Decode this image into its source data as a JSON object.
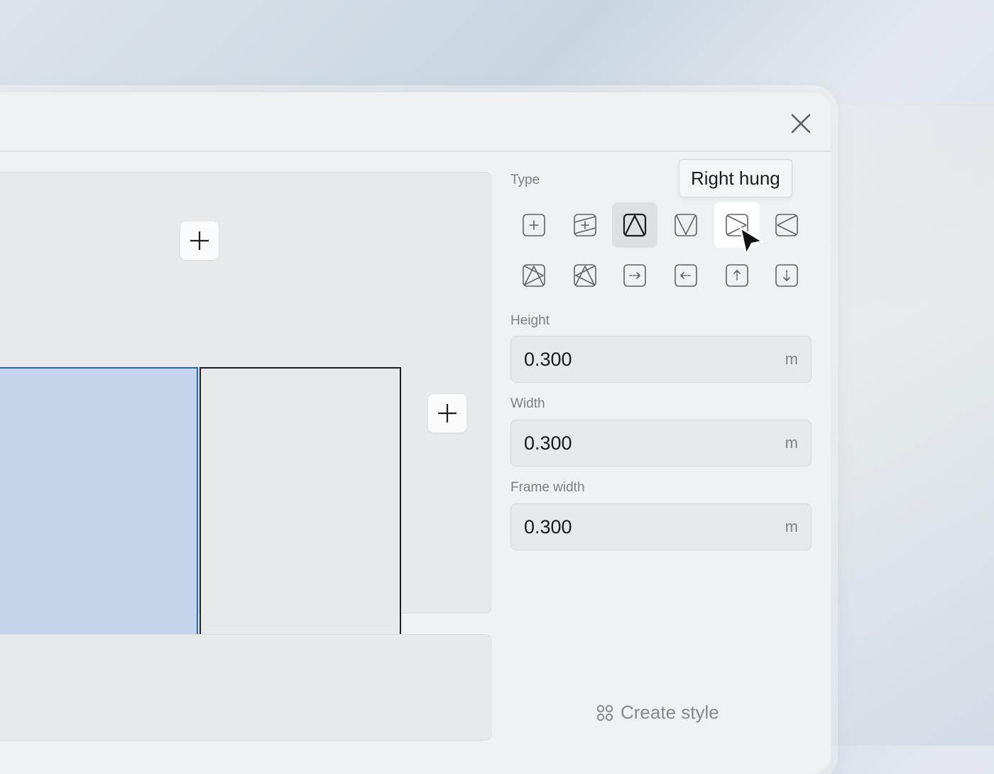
{
  "panel": {
    "type_label": "Type",
    "tooltip": "Right hung",
    "height": {
      "label": "Height",
      "value": "0.300",
      "unit": "m"
    },
    "width": {
      "label": "Width",
      "value": "0.300",
      "unit": "m"
    },
    "frame_width": {
      "label": "Frame width",
      "value": "0.300",
      "unit": "m"
    },
    "create_style_label": "Create style"
  },
  "type_options": [
    {
      "icon": "fixed-plus-icon",
      "state": "normal"
    },
    {
      "icon": "fixed-hatched-icon",
      "state": "normal"
    },
    {
      "icon": "top-hung-icon",
      "state": "active"
    },
    {
      "icon": "bottom-hung-icon",
      "state": "normal"
    },
    {
      "icon": "right-hung-icon",
      "state": "hover"
    },
    {
      "icon": "left-hung-icon",
      "state": "normal"
    },
    {
      "icon": "tilt-turn-left-icon",
      "state": "normal"
    },
    {
      "icon": "tilt-turn-right-icon",
      "state": "normal"
    },
    {
      "icon": "slide-right-icon",
      "state": "normal"
    },
    {
      "icon": "slide-left-icon",
      "state": "normal"
    },
    {
      "icon": "slide-up-icon",
      "state": "normal"
    },
    {
      "icon": "slide-down-icon",
      "state": "normal"
    }
  ],
  "colors": {
    "selected_pane_fill": "#c5d5ec",
    "selected_pane_border": "#2266cc",
    "active_type_bg": "#dddfe2"
  }
}
